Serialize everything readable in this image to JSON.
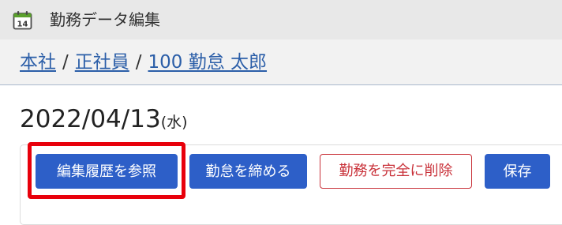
{
  "window": {
    "title": "勤務データ編集",
    "icon": "calendar-icon",
    "icon_day": "14"
  },
  "breadcrumb": {
    "items": [
      "本社",
      "正社員",
      "100 勤怠 太郎"
    ],
    "separator": "/"
  },
  "record": {
    "date": "2022/04/13",
    "weekday": "(水)"
  },
  "actions": {
    "view_history": "編集履歴を参照",
    "close_attendance": "勤怠を締める",
    "delete_permanently": "勤務を完全に削除",
    "save": "保存"
  },
  "colors": {
    "primary": "#2d5fc8",
    "danger": "#c9323a",
    "highlight": "#e8000b",
    "link": "#2b5ea8"
  }
}
